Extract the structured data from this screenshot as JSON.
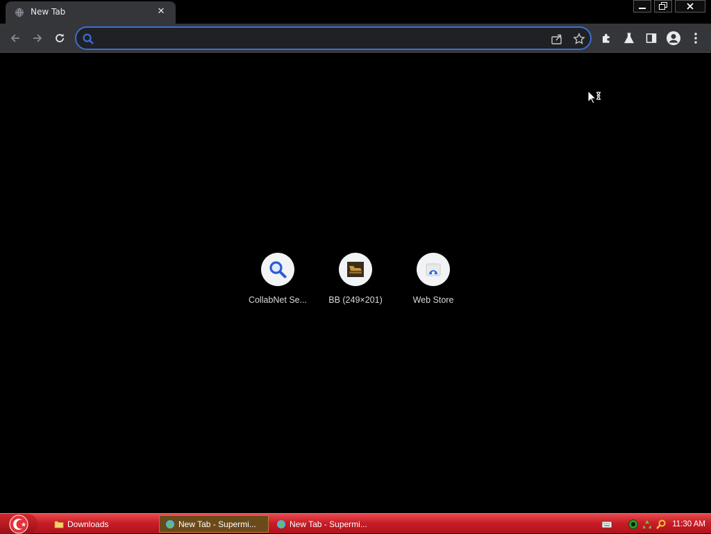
{
  "browser": {
    "tab": {
      "title": "New Tab",
      "close_glyph": "✕"
    },
    "window_controls": [
      "minimize-icon",
      "restore-icon",
      "close-icon"
    ],
    "omnibox": {
      "value": "",
      "placeholder": ""
    },
    "accent_color": "#3b6fd4"
  },
  "shortcuts": [
    {
      "label": "CollabNet Se...",
      "icon": "search-icon"
    },
    {
      "label": "BB (249×201)",
      "icon": "image-thumbnail"
    },
    {
      "label": "Web Store",
      "icon": "web-store-icon"
    }
  ],
  "taskbar": {
    "items": [
      {
        "label": "Downloads",
        "icon": "folder-icon"
      },
      {
        "label": "New Tab - Supermi...",
        "icon": "browser-icon",
        "active": true
      },
      {
        "label": "New Tab - Supermi...",
        "icon": "browser-icon",
        "active": false
      }
    ],
    "clock": "11:30 AM",
    "color": "#c81e27"
  }
}
